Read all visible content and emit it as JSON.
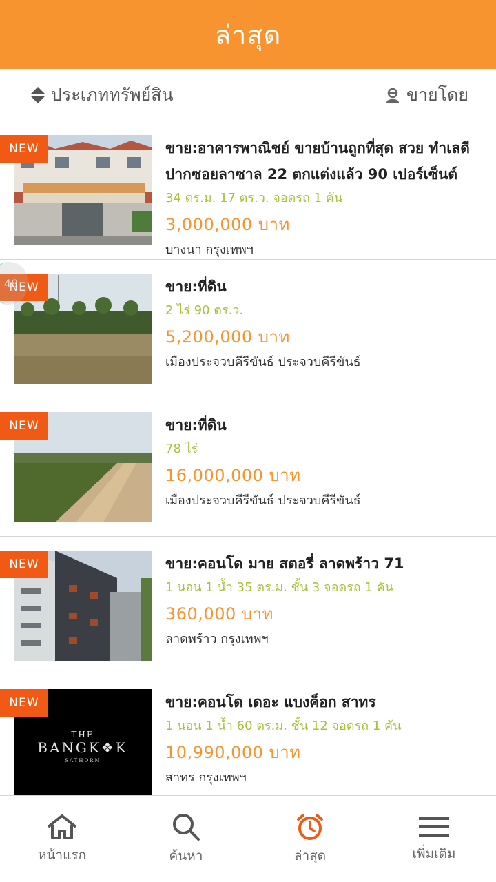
{
  "header": {
    "title": "ล่าสุด"
  },
  "filters": {
    "type_label": "ประเภททรัพย์สิน",
    "seller_label": "ขายโดย"
  },
  "listings": [
    {
      "badge": "NEW",
      "title": "ขาย:อาคารพาณิชย์ ขายบ้านถูกที่สุด สวย ทำเลดี ปากซอยลาซาล 22 ตกแต่งแล้ว 90 เปอร์เซ็นต์",
      "detail": "34 ตร.ม. 17 ตร.ว. จอดรถ 1 คัน",
      "price": "3,000,000 บาท",
      "location": "บางนา กรุงเทพฯ"
    },
    {
      "badge": "NEW",
      "title": "ขาย:ที่ดิน",
      "detail": "2 ไร่ 90 ตร.ว.",
      "price": "5,200,000 บาท",
      "location": "เมืองประจวบคีรีขันธ์ ประจวบคีรีขันธ์"
    },
    {
      "badge": "NEW",
      "title": "ขาย:ที่ดิน",
      "detail": "78 ไร่",
      "price": "16,000,000 บาท",
      "location": "เมืองประจวบคีรีขันธ์ ประจวบคีรีขันธ์"
    },
    {
      "badge": "NEW",
      "title": "ขาย:คอนโด มาย สตอรี่ ลาดพร้าว 71",
      "detail": "1 นอน 1 น้ำ 35 ตร.ม. ชั้น 3 จอดรถ 1 คัน",
      "price": "360,000 บาท",
      "location": "ลาดพร้าว กรุงเทพฯ"
    },
    {
      "badge": "NEW",
      "title": "ขาย:คอนโด เดอะ แบงค็อก สาทร",
      "detail": "1 นอน 1 น้ำ 60 ตร.ม. ชั้น 12 จอดรถ 1 คัน",
      "price": "10,990,000 บาท",
      "location": "สาทร กรุงเทพฯ",
      "logo_text": "THE BANGK❖K SATHORN"
    }
  ],
  "side_tab": {
    "label": "48"
  },
  "tabbar": [
    {
      "label": "หน้าแรก",
      "icon": "home-icon"
    },
    {
      "label": "ค้นหา",
      "icon": "search-icon"
    },
    {
      "label": "ล่าสุด",
      "icon": "alarm-clock-icon",
      "active": true
    },
    {
      "label": "เพิ่มเติม",
      "icon": "menu-icon"
    }
  ],
  "colors": {
    "brand_orange": "#f7942f",
    "badge_orange": "#f05a14",
    "detail_green": "#a6c23a"
  }
}
